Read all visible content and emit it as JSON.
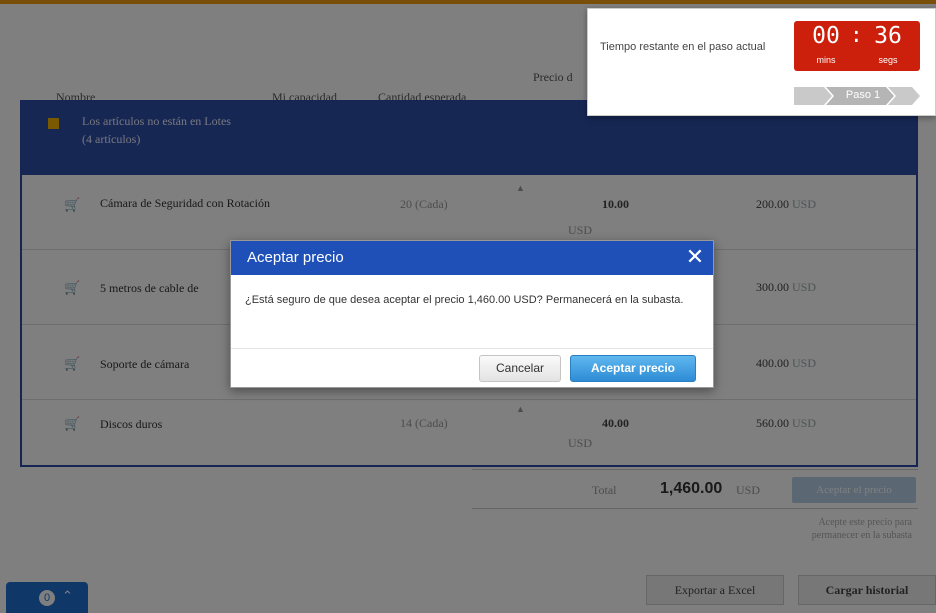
{
  "colors": {
    "accent": "#f39c12",
    "group_header": "#2d4ea6",
    "modal_header": "#1e50b8",
    "timer_red": "#cc1f0c",
    "primary_button": "#2e8cd6"
  },
  "table": {
    "headers": {
      "name": "Nombre",
      "capacity": "Mi capacidad",
      "expected": "Cantidad esperada",
      "price": "Precio d"
    },
    "group": {
      "title": "Los artículos no están en Lotes",
      "count": "(4 artículos)"
    },
    "rows": [
      {
        "name": "Cámara de Seguridad con Rotación",
        "capacity": "20 (Cada)",
        "price": "10.00",
        "currency": "USD",
        "subtotal": "200.00",
        "subtotal_currency": "USD"
      },
      {
        "name": "5 metros de cable de",
        "subtotal": "300.00",
        "subtotal_currency": "USD"
      },
      {
        "name": "Soporte de cámara",
        "subtotal": "400.00",
        "subtotal_currency": "USD"
      },
      {
        "name": "Discos duros",
        "capacity": "14 (Cada)",
        "price": "40.00",
        "currency": "USD",
        "subtotal": "560.00",
        "subtotal_currency": "USD"
      }
    ]
  },
  "totals": {
    "label": "Total",
    "value": "1,460.00",
    "currency": "USD",
    "accept_label": "Aceptar el precio"
  },
  "hint": "Acepte este precio para permanecer en la subasta",
  "actions": {
    "export": "Exportar a Excel",
    "history": "Cargar historial"
  },
  "chat": {
    "count": "0",
    "chevron_icon": "chevron-up-icon"
  },
  "timer": {
    "label": "Tiempo restante en el paso actual",
    "mins": "00",
    "sep": ":",
    "secs": "36",
    "mins_label": "mins",
    "secs_label": "segs",
    "step": "Paso 1"
  },
  "modal": {
    "title": "Aceptar precio",
    "message": "¿Está seguro de que desea aceptar el precio 1,460.00 USD? Permanecerá en la subasta.",
    "cancel": "Cancelar",
    "accept": "Aceptar precio",
    "close_icon": "close-icon"
  }
}
